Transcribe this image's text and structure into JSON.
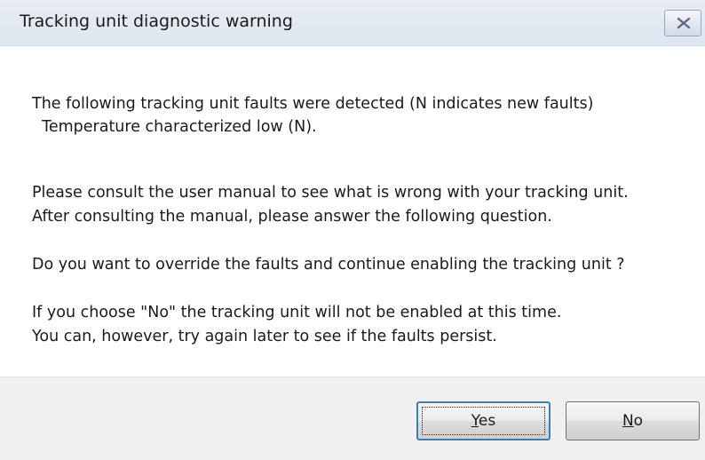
{
  "window": {
    "title": "Tracking unit diagnostic warning",
    "close_icon": "close-icon"
  },
  "message": {
    "line1": "The following tracking unit faults were detected (N indicates new faults)",
    "line2": "  Temperature characterized low (N).",
    "line3": "Please consult the user manual to see what is wrong with your tracking unit.",
    "line4": "After consulting the manual, please answer the following question.",
    "line5": "Do you want to override the faults and continue enabling the tracking unit ?",
    "line6": "If you choose \"No\" the tracking unit will not be enabled at this time.",
    "line7": "You can, however, try again later to see if the faults persist."
  },
  "buttons": {
    "yes_mnemonic": "Y",
    "yes_rest": "es",
    "no_mnemonic": "N",
    "no_rest": "o"
  }
}
